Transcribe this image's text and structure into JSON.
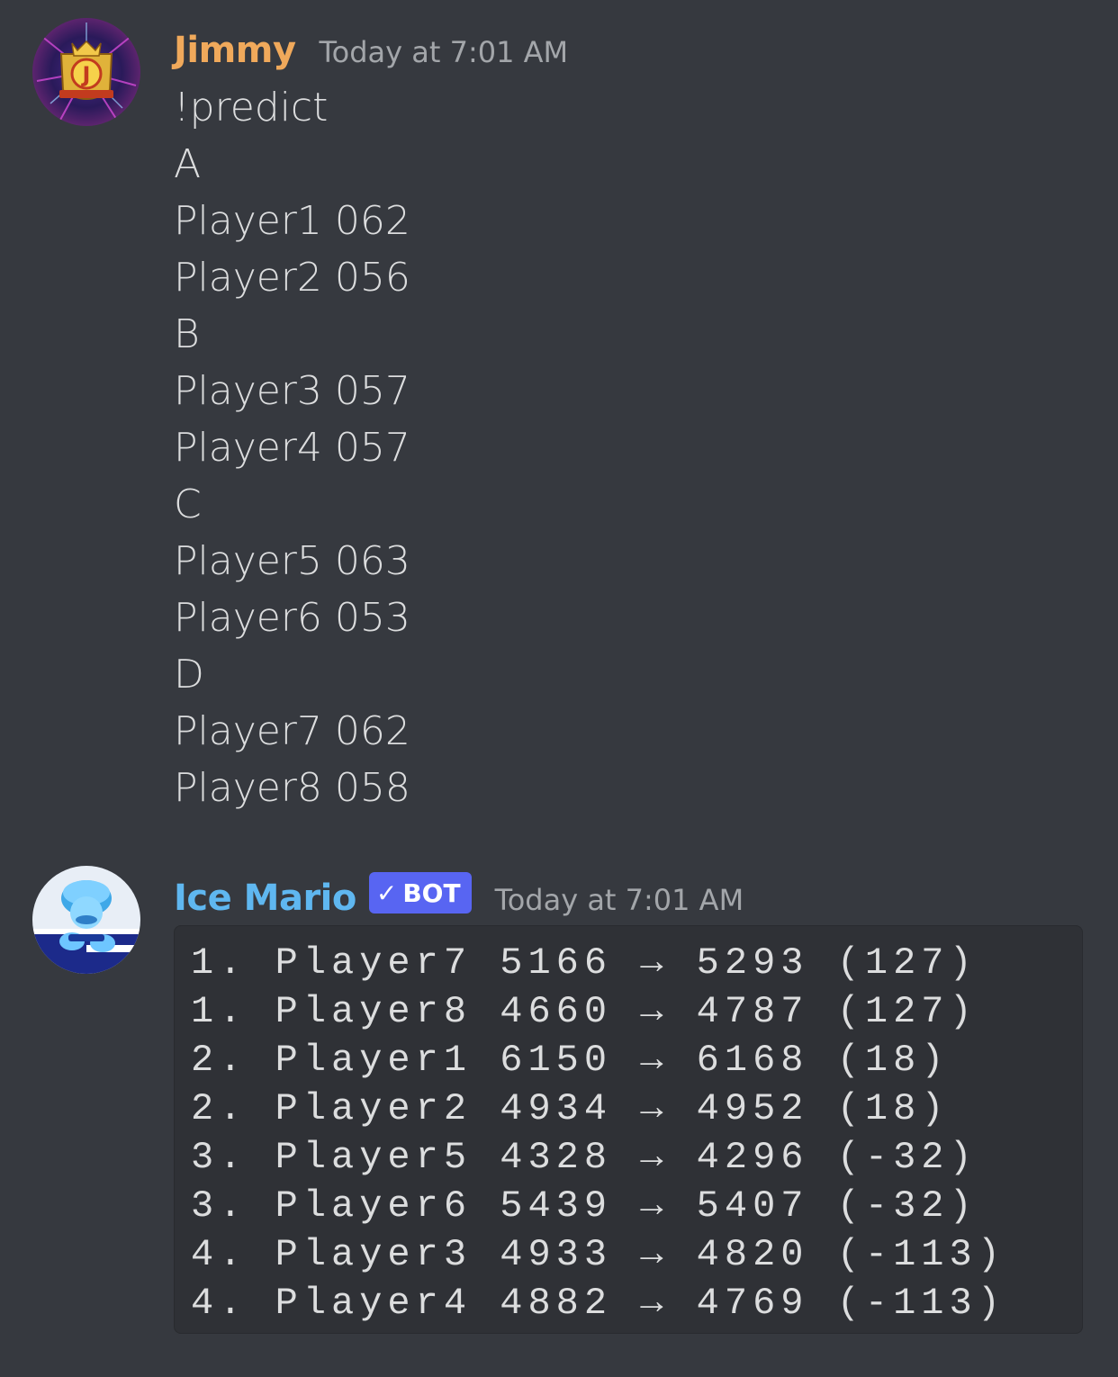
{
  "messages": {
    "jimmy": {
      "username": "Jimmy",
      "timestamp": "Today at 7:01 AM",
      "avatar_icon": "gold-crest-j-logo-icon",
      "lines": [
        "!predict",
        "A",
        "Player1 062",
        "Player2 056",
        "B",
        "Player3 057",
        "Player4 057",
        "C",
        "Player5 063",
        "Player6 053",
        "D",
        "Player7 062",
        "Player8 058"
      ]
    },
    "bot": {
      "username": "Ice Mario",
      "bot_tag": "BOT",
      "bot_check": "✓",
      "timestamp": "Today at 7:01 AM",
      "avatar_icon": "ice-mario-avatar-icon",
      "code_lines": [
        "1. Player7 5166 → 5293 (127)",
        "1. Player8 4660 → 4787 (127)",
        "2. Player1 6150 → 6168 (18)",
        "2. Player2 4934 → 4952 (18)",
        "3. Player5 4328 → 4296 (-32)",
        "3. Player6 5439 → 5407 (-32)",
        "4. Player3 4933 → 4820 (-113)",
        "4. Player4 4882 → 4769 (-113)"
      ]
    }
  },
  "colors": {
    "background": "#36393f",
    "codeblock_bg": "#2f3136",
    "jimmy_name": "#f0a95b",
    "bot_name": "#5fb7f0",
    "bot_tag": "#5865f2",
    "timestamp": "#a3a6aa",
    "text": "#dcddde"
  }
}
